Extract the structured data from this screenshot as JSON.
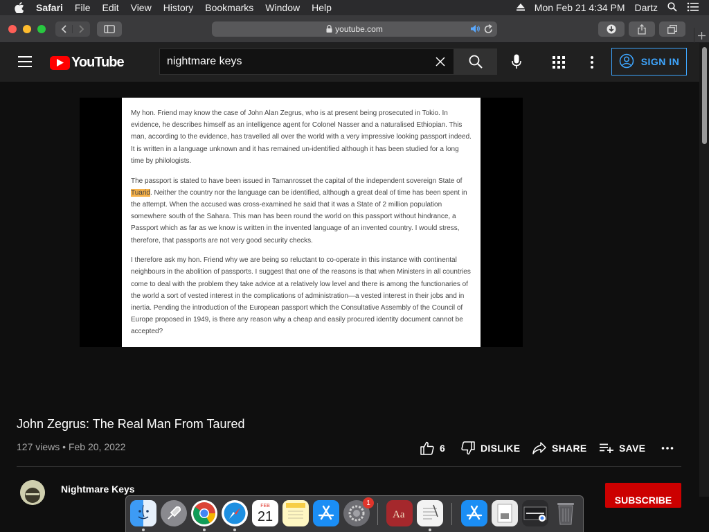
{
  "menubar": {
    "app_name": "Safari",
    "items": [
      "File",
      "Edit",
      "View",
      "History",
      "Bookmarks",
      "Window",
      "Help"
    ],
    "datetime": "Mon Feb 21  4:34 PM",
    "user": "Dartz"
  },
  "browser": {
    "url": "youtube.com"
  },
  "youtube": {
    "logo_text": "YouTube",
    "search": {
      "value": "nightmare keys"
    },
    "signin_label": "SIGN IN"
  },
  "video": {
    "document": {
      "paragraphs": [
        "My hon. Friend may know the case of John Alan Zegrus, who is at present being prosecuted in Tokio. In evidence, he describes himself as an intelligence agent for Colonel Nasser and a naturalised Ethiopian. This man, according to the evidence, has travelled all over the world with a very impressive looking passport indeed. It is written in a language unknown and it has remained un-identified although it has been studied for a long time by philologists.",
        "I therefore ask my hon. Friend why we are being so reluctant to co-operate in this instance with continental neighbours in the abolition of passports. I suggest that one of the reasons is that when Ministers in all countries come to deal with the problem they take advice at a relatively low level and there is among the functionaries of the world a sort of vested interest in the complications of administration—a vested interest in their jobs and in inertia. Pending the introduction of the European passport which the Consultative Assembly of the Council of Europe proposed in 1949, is there any reason why a cheap and easily procured identity document cannot be accepted?"
      ],
      "p2_before": "The passport is stated to have been issued in Tamanrosset the capital of the independent sovereign State of ",
      "p2_highlight": "Tuarid",
      "p2_after": ". Neither the country nor the language can be identified, although a great deal of time has been spent in the attempt. When the accused was cross-examined he said that it was a State of 2 million population somewhere south of the Sahara. This man has been round the world on this passport without hindrance, a Passport which as far as we know is written in the invented language of an invented country. I would stress, therefore, that passports are not very good security checks."
    },
    "title": "John Zegrus: The Real Man From Taured",
    "views": "127 views",
    "date": "Feb 20, 2022",
    "likes": "6",
    "dislike_label": "DISLIKE",
    "share_label": "SHARE",
    "save_label": "SAVE",
    "channel_name": "Nightmare Keys",
    "subscribe_label": "SUBSCRIBE"
  },
  "dock": {
    "calendar_month": "FEB",
    "calendar_day": "21",
    "badge_count": "1"
  }
}
